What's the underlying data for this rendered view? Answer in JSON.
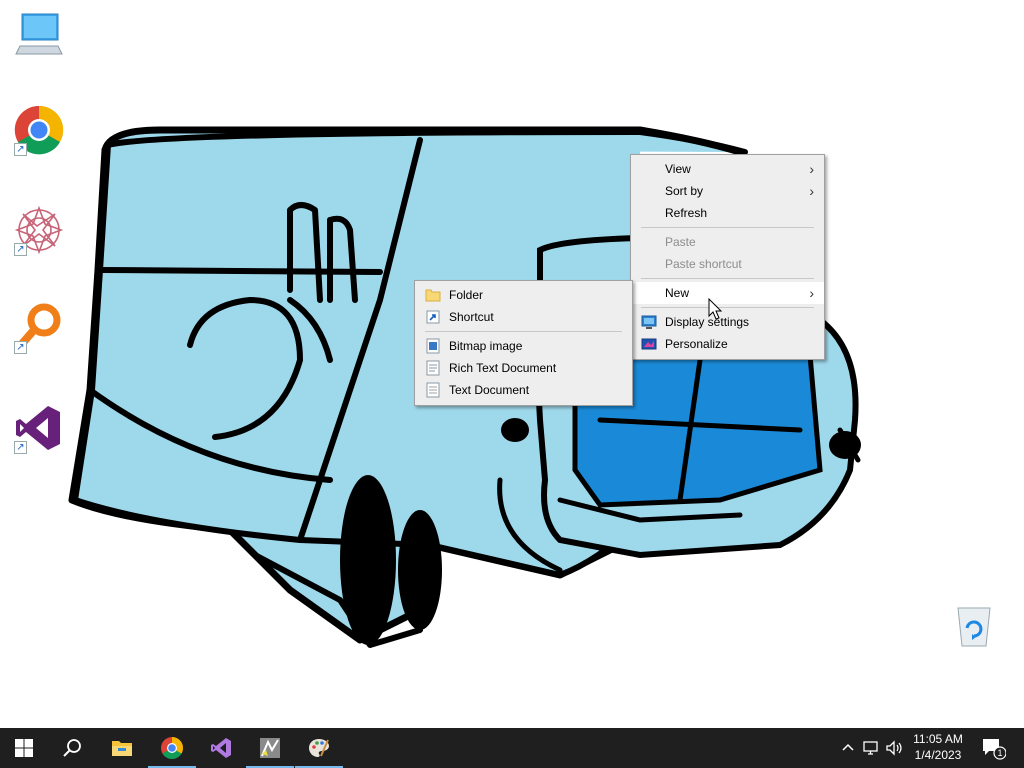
{
  "desktop": {
    "icons": [
      {
        "name": "this-pc-icon"
      },
      {
        "name": "chrome-shortcut-icon"
      },
      {
        "name": "mandala-app-shortcut-icon"
      },
      {
        "name": "search-app-shortcut-icon"
      },
      {
        "name": "visual-studio-shortcut-icon"
      },
      {
        "name": "recycle-bin-icon"
      }
    ]
  },
  "context_menu": {
    "items": [
      {
        "label": "View",
        "has_submenu": true,
        "enabled": true
      },
      {
        "label": "Sort by",
        "has_submenu": true,
        "enabled": true
      },
      {
        "label": "Refresh",
        "enabled": true
      },
      {
        "label": "Paste",
        "enabled": false
      },
      {
        "label": "Paste shortcut",
        "enabled": false
      },
      {
        "label": "New",
        "has_submenu": true,
        "enabled": true,
        "highlighted": true
      },
      {
        "label": "Display settings",
        "icon": "display-icon",
        "enabled": true
      },
      {
        "label": "Personalize",
        "icon": "personalize-icon",
        "enabled": true
      }
    ]
  },
  "new_submenu": {
    "items": [
      {
        "label": "Folder",
        "icon": "folder-icon"
      },
      {
        "label": "Shortcut",
        "icon": "shortcut-icon"
      },
      {
        "label": "Bitmap image",
        "icon": "bitmap-icon"
      },
      {
        "label": "Rich Text Document",
        "icon": "rtf-document-icon"
      },
      {
        "label": "Text Document",
        "icon": "text-document-icon"
      }
    ]
  },
  "taskbar": {
    "buttons": [
      {
        "name": "start-button"
      },
      {
        "name": "search-button"
      },
      {
        "name": "file-explorer-button"
      },
      {
        "name": "chrome-button",
        "running": true
      },
      {
        "name": "visual-studio-button"
      },
      {
        "name": "app-button",
        "running": true
      },
      {
        "name": "paint-button",
        "running": true
      }
    ],
    "clock": {
      "time": "11:05 AM",
      "date": "1/4/2023"
    },
    "notification_count": "1"
  },
  "colors": {
    "taskbar_bg": "#1f1f1f",
    "menu_bg": "#eeeeee",
    "wallpaper_fill": "#9ed9eb",
    "window_blue": "#1a8ad8"
  }
}
